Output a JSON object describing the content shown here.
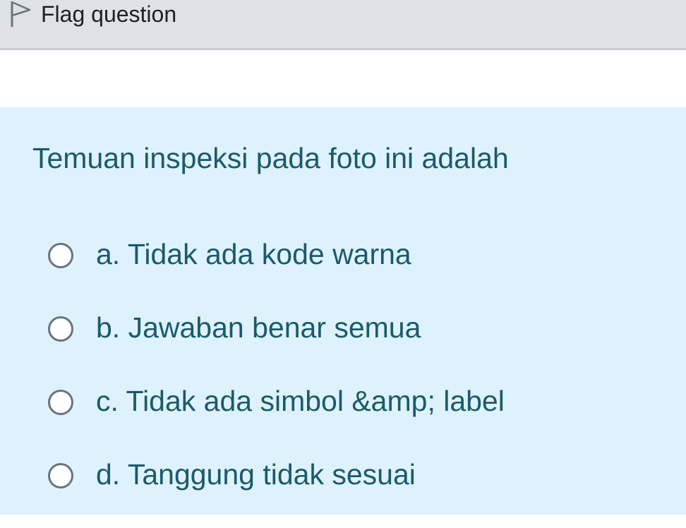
{
  "info": {
    "flag_label": "Flag question"
  },
  "question": {
    "text": "Temuan inspeksi pada foto ini adalah"
  },
  "answers": [
    {
      "label": "a. Tidak ada kode warna",
      "selected": false
    },
    {
      "label": "b. Jawaban benar semua",
      "selected": false
    },
    {
      "label": "c. Tidak ada simbol &amp; label",
      "selected": false
    },
    {
      "label": "d. Tanggung tidak sesuai",
      "selected": false
    }
  ],
  "colors": {
    "info_bar_bg": "#dee2e6",
    "panel_bg": "#def2fd",
    "question_text": "#1a5a6a",
    "radio_border": "#6a737b"
  },
  "icons": {
    "flag": "flag-outline-icon"
  }
}
